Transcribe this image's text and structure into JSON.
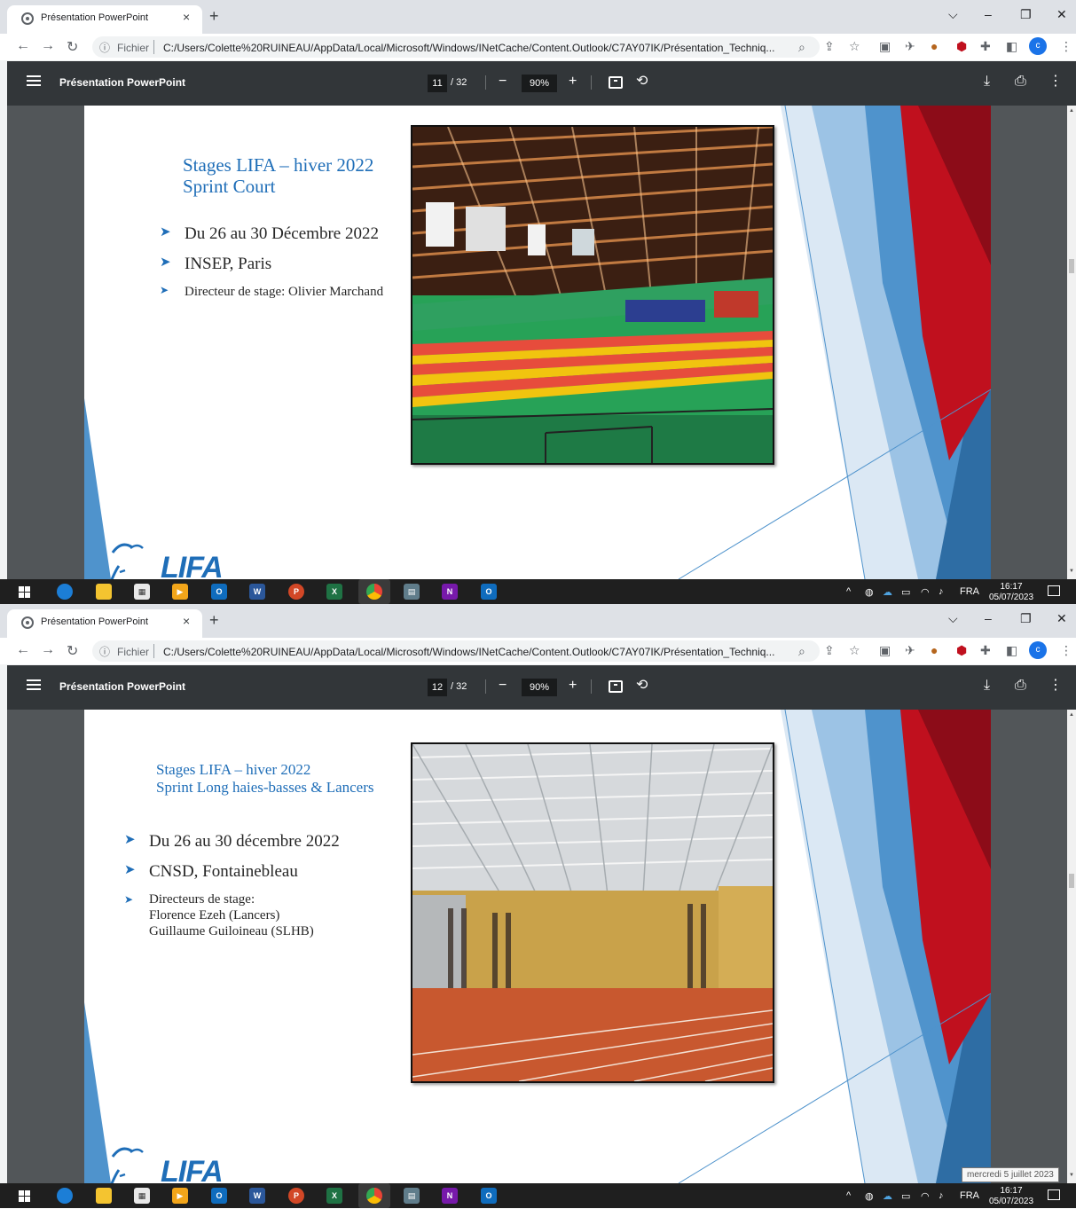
{
  "screens": [
    {
      "tab": {
        "title": "Présentation PowerPoint",
        "close": "×"
      },
      "new_tab": "+",
      "window_controls": {
        "chevron": "⌵",
        "minimize": "–",
        "restore": "❐",
        "close": "✕"
      },
      "address": {
        "info_icon": "ⓘ",
        "scheme_label": "Fichier",
        "url": "C:/Users/Colette%20RUINEAU/AppData/Local/Microsoft/Windows/INetCache/Content.Outlook/C7AY07IK/Présentation_Techniq..."
      },
      "pdf": {
        "title": "Présentation PowerPoint",
        "page_current": "11",
        "page_total": "/ 32",
        "zoom": "90%"
      },
      "slide": {
        "title_line1": "Stages LIFA – hiver 2022",
        "title_line2": "Sprint Court",
        "bullets": [
          "Du 26 au 30 Décembre 2022",
          "INSEP, Paris",
          "Directeur de stage: Olivier Marchand"
        ],
        "logo_text": "LIFA"
      },
      "taskbar": {
        "lang": "FRA",
        "time": "16:17",
        "date": "05/07/2023"
      }
    },
    {
      "tab": {
        "title": "Présentation PowerPoint",
        "close": "×"
      },
      "new_tab": "+",
      "window_controls": {
        "chevron": "⌵",
        "minimize": "–",
        "restore": "❐",
        "close": "✕"
      },
      "address": {
        "info_icon": "ⓘ",
        "scheme_label": "Fichier",
        "url": "C:/Users/Colette%20RUINEAU/AppData/Local/Microsoft/Windows/INetCache/Content.Outlook/C7AY07IK/Présentation_Techniq..."
      },
      "pdf": {
        "title": "Présentation PowerPoint",
        "page_current": "12",
        "page_total": "/ 32",
        "zoom": "90%"
      },
      "slide": {
        "title_line1": "Stages LIFA – hiver 2022",
        "title_line2": "Sprint Long haies-basses & Lancers",
        "bullets": [
          "Du 26 au 30 décembre 2022",
          "CNSD, Fontainebleau",
          "Directeurs de stage:",
          "Florence Ezeh (Lancers)",
          "Guillaume Guiloineau (SLHB)"
        ],
        "logo_text": "LIFA"
      },
      "taskbar": {
        "lang": "FRA",
        "time": "16:17",
        "date": "05/07/2023",
        "tooltip": "mercredi 5 juillet 2023"
      }
    }
  ],
  "colors": {
    "chrome_tabbar": "#dee1e6",
    "pdf_toolbar": "#323639",
    "pdf_background": "#525659",
    "slide_title_blue": "#1f6eb8",
    "accent_red": "#c0101e",
    "taskbar": "#1f1f1f"
  },
  "icons": [
    "globe-icon",
    "back-arrow-icon",
    "forward-arrow-icon",
    "reload-icon",
    "zoom-icon",
    "share-icon",
    "star-icon",
    "extension-icon",
    "puzzle-icon",
    "sidebar-icon",
    "kebab-menu-icon",
    "hamburger-icon",
    "minus-icon",
    "plus-icon",
    "fit-page-icon",
    "rotate-icon",
    "download-icon",
    "print-icon",
    "windows-start-icon",
    "edge-icon",
    "file-explorer-icon",
    "store-icon",
    "outlook-icon",
    "word-icon",
    "powerpoint-icon",
    "excel-icon",
    "chrome-icon",
    "onenote-icon",
    "notification-icon"
  ]
}
